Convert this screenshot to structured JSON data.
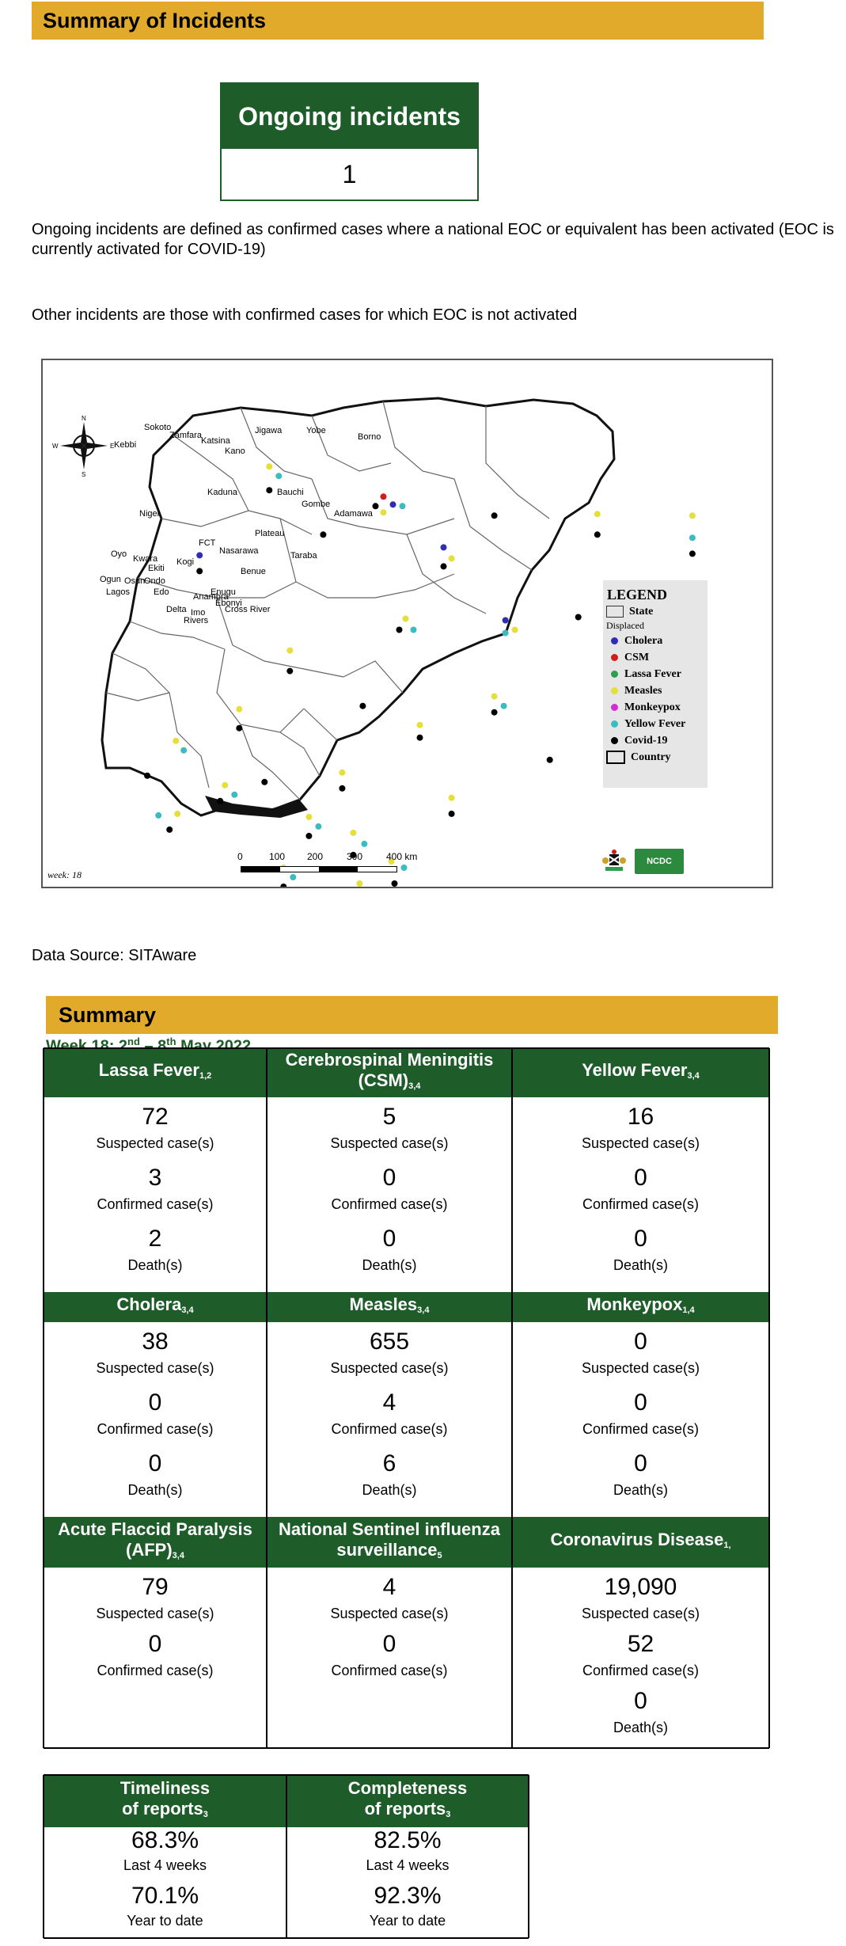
{
  "header": {
    "title": "Summary of Incidents"
  },
  "ongoing": {
    "label": "Ongoing incidents",
    "value": "1"
  },
  "notes": {
    "ongoing_definition": "Ongoing incidents are defined as confirmed cases where a national EOC or equivalent has been activated (EOC is currently activated for COVID-19)",
    "other_definition": "Other incidents are those with confirmed cases for which EOC is not activated"
  },
  "map": {
    "compass_labels": [
      "N",
      "S",
      "E",
      "W"
    ],
    "week_label": "week: 18",
    "scale_labels": [
      "0",
      "100",
      "200",
      "300",
      "400 km"
    ],
    "logo_text": "NCDC",
    "states": [
      "Sokoto",
      "Zamfara",
      "Katsina",
      "Jigawa",
      "Yobe",
      "Borno",
      "Kebbi",
      "Kano",
      "Kaduna",
      "Bauchi",
      "Gombe",
      "Adamawa",
      "Niger",
      "FCT",
      "Nasarawa",
      "Plateau",
      "Taraba",
      "Oyo",
      "Kwara",
      "Kogi",
      "Benue",
      "Ogun",
      "Osun",
      "Ekiti",
      "Ondo",
      "Lagos",
      "Edo",
      "Anambra",
      "Enugu",
      "Ebonyi",
      "Delta",
      "Imo",
      "Cross River",
      "Rivers"
    ],
    "legend": {
      "title": "LEGEND",
      "state_label": "State",
      "displaced_label": "Displaced",
      "items": [
        {
          "label": "Cholera",
          "color": "#2d2db5"
        },
        {
          "label": "CSM",
          "color": "#d01c1c"
        },
        {
          "label": "Lassa Fever",
          "color": "#2e9e4a"
        },
        {
          "label": "Measles",
          "color": "#e4df3a"
        },
        {
          "label": "Monkeypox",
          "color": "#d42bd4"
        },
        {
          "label": "Yellow Fever",
          "color": "#3cbcc0"
        },
        {
          "label": "Covid-19",
          "color": "#000000"
        }
      ],
      "country_label": "Country"
    }
  },
  "data_source": "Data Source: SITAware",
  "summary": {
    "title": "Summary",
    "week_prefix": "Week 18: 2",
    "week_sup1": "nd",
    "week_mid": " – 8",
    "week_sup2": "th",
    "week_suffix": " May 2022",
    "diseases": [
      {
        "name": "Lassa Fever",
        "sub": "1,2",
        "suspected": "72",
        "confirmed": "3",
        "deaths": "2"
      },
      {
        "name": "Cerebrospinal Meningitis (CSM)",
        "sub": "3,4",
        "suspected": "5",
        "confirmed": "0",
        "deaths": "0"
      },
      {
        "name": "Yellow Fever",
        "sub": "3,4",
        "suspected": "16",
        "confirmed": "0",
        "deaths": "0"
      },
      {
        "name": "Cholera",
        "sub": "3,4",
        "suspected": "38",
        "confirmed": "0",
        "deaths": "0"
      },
      {
        "name": "Measles",
        "sub": "3,4",
        "suspected": "655",
        "confirmed": "4",
        "deaths": "6"
      },
      {
        "name": "Monkeypox",
        "sub": "1,4",
        "suspected": "0",
        "confirmed": "0",
        "deaths": "0"
      },
      {
        "name": "Acute Flaccid Paralysis (AFP)",
        "sub": "3,4",
        "suspected": "79",
        "confirmed": "0"
      },
      {
        "name": "National Sentinel influenza surveillance",
        "sub": "5",
        "suspected": "4",
        "confirmed": "0"
      },
      {
        "name": "Coronavirus Disease",
        "sub": "1,",
        "suspected": "19,090",
        "confirmed": "52",
        "deaths": "0"
      }
    ],
    "labels": {
      "suspected": "Suspected case(s)",
      "confirmed": "Confirmed case(s)",
      "deaths": "Death(s)"
    }
  },
  "reports": {
    "timeliness": {
      "title_line1": "Timeliness",
      "title_line2": "of reports",
      "sub": "3",
      "last4": "68.3%",
      "ytd": "70.1%"
    },
    "completeness": {
      "title_line1": "Completeness",
      "title_line2": "of reports",
      "sub": "3",
      "last4": "82.5%",
      "ytd": "92.3%"
    },
    "labels": {
      "last4": "Last 4 weeks",
      "ytd": "Year to date"
    }
  }
}
